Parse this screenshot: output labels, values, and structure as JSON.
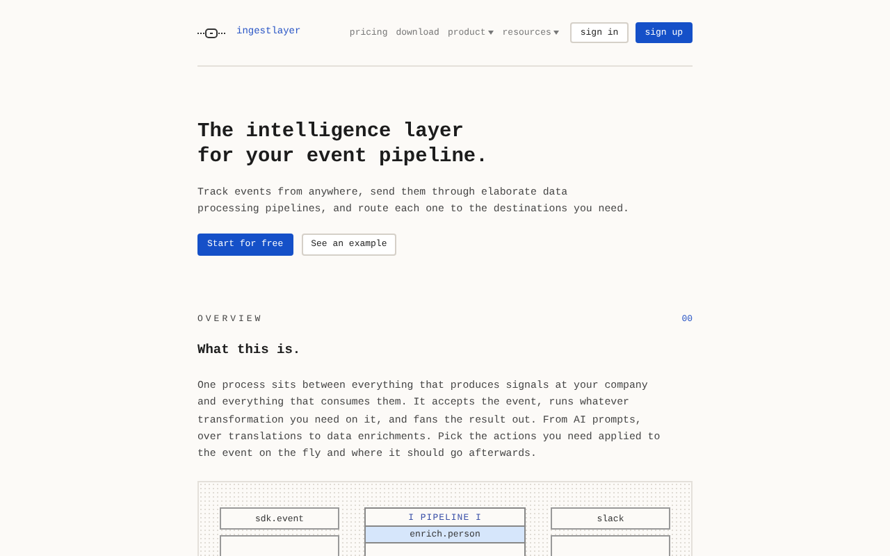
{
  "brand": "ingestlayer",
  "nav": [
    {
      "label": "pricing",
      "dropdown": false
    },
    {
      "label": "download",
      "dropdown": false
    },
    {
      "label": "product",
      "dropdown": true
    },
    {
      "label": "resources",
      "dropdown": true
    }
  ],
  "auth": [
    {
      "label": "sign in",
      "kind": "outline"
    },
    {
      "label": "sign up",
      "kind": "primary"
    }
  ],
  "hero": {
    "title": [
      "The intelligence layer",
      "for your event pipeline."
    ],
    "text": [
      "Track events from anywhere, send them through elaborate data",
      "processing pipelines, and route each one to the destinations you need."
    ],
    "actions": [
      {
        "label": "Start for free",
        "kind": "primary"
      },
      {
        "label": "See an example",
        "kind": "outline"
      }
    ]
  },
  "overview": {
    "label": "OVERVIEW",
    "number": "00",
    "heading": "What this is.",
    "text": "One process sits between everything that produces signals at your company and everything that consumes them. It accepts the event, runs whatever transformation you need on it, and fans the result out. From AI prompts, over translations to data enrichments. Pick the actions you need applied to the event on the fly and where it should go afterwards."
  },
  "diagram": {
    "sources": [
      "sdk.event"
    ],
    "pipeline": {
      "title": "I PIPELINE I",
      "steps": [
        "enrich.person"
      ]
    },
    "destinations": [
      "slack"
    ]
  }
}
